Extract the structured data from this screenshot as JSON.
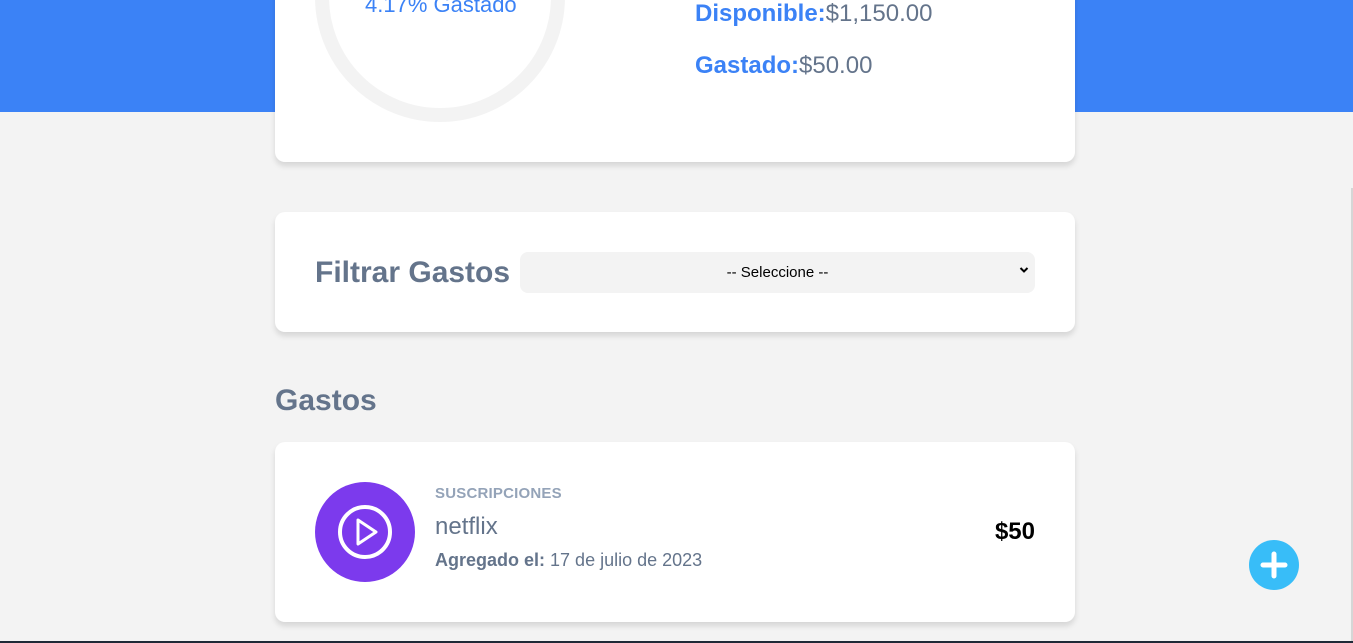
{
  "budget": {
    "percent_label": "4.17% Gastado",
    "available_label": "Disponible:",
    "available_value": "$1,150.00",
    "spent_label": "Gastado:",
    "spent_value": "$50.00"
  },
  "filter": {
    "title": "Filtrar Gastos",
    "selected": "-- Seleccione --"
  },
  "expenses": {
    "title": "Gastos",
    "items": [
      {
        "category": "SUSCRIPCIONES",
        "name": "netflix",
        "date_label": "Agregado el:",
        "date_value": "17 de julio de 2023",
        "amount": "$50",
        "icon": "play-circle-icon"
      }
    ]
  },
  "colors": {
    "primary": "#3b82f6",
    "background": "#f3f3f3",
    "subscription_icon_bg": "#7c3aed",
    "fab": "#38bdf8"
  },
  "fab": {
    "icon": "plus-icon"
  }
}
